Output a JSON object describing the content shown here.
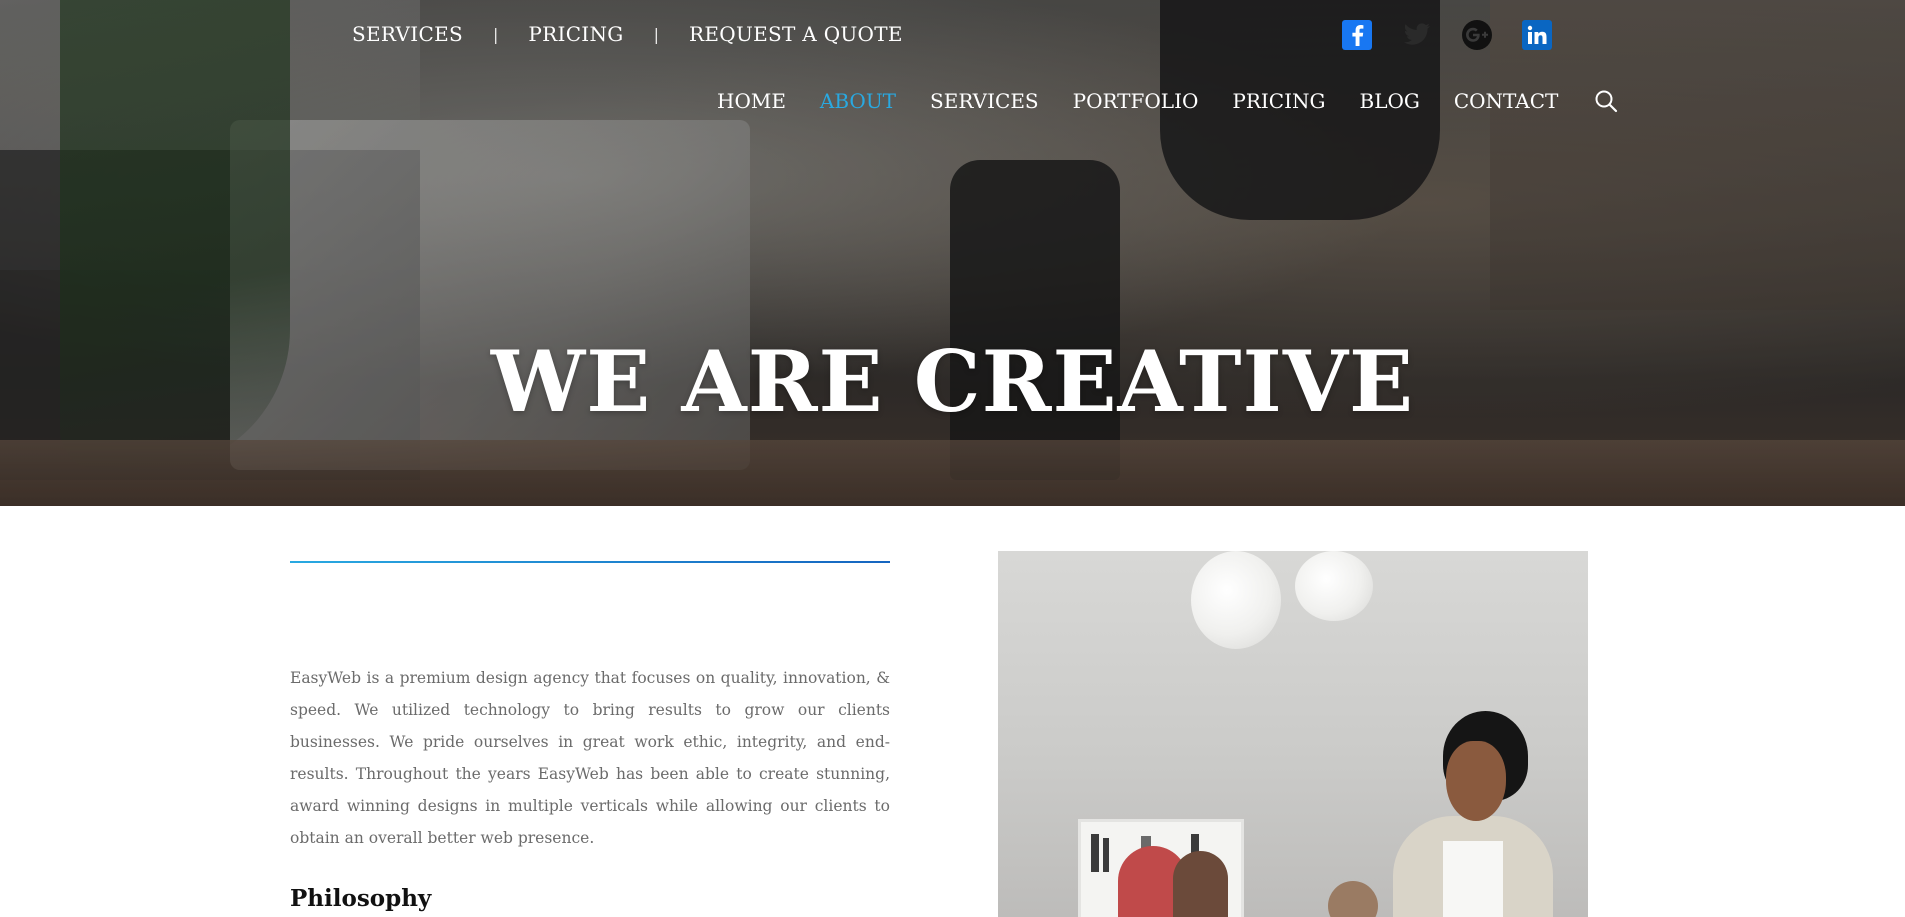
{
  "topbar": {
    "links": [
      "SERVICES",
      "PRICING",
      "REQUEST A QUOTE"
    ],
    "separator": "|"
  },
  "social": {
    "icons": [
      "facebook-icon",
      "twitter-icon",
      "google-plus-icon",
      "linkedin-icon"
    ],
    "colors": {
      "facebook": "#1877f2",
      "linkedin": "#0a66c2",
      "google_plus": "#111111"
    }
  },
  "nav": {
    "items": [
      "HOME",
      "ABOUT",
      "SERVICES",
      "PORTFOLIO",
      "PRICING",
      "BLOG",
      "CONTACT"
    ],
    "active": "ABOUT",
    "search_icon": "search-icon"
  },
  "hero": {
    "title": "WE ARE CREATIVE"
  },
  "about": {
    "paragraph": "EasyWeb is a premium design agency that focuses on quality, innovation, & speed. We utilized technology to bring results to grow our clients businesses. We pride ourselves in great work ethic, integrity, and end-results. Throughout the years EasyWeb has been able to create stunning, award winning designs in multiple verticals while allowing our clients to obtain an overall better web presence.",
    "heading": "Philosophy"
  },
  "colors": {
    "accent": "#29a9e1",
    "accent_dark": "#1565c0",
    "body_text": "#6b6b6b",
    "heading": "#111111"
  }
}
